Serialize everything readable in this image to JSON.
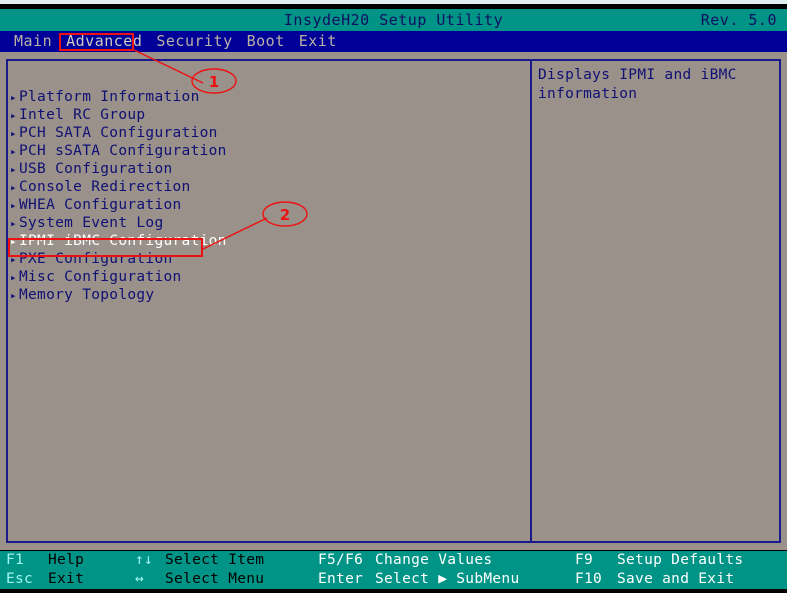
{
  "window": {
    "title": "InsydeH20 Setup Utility",
    "revision": "Rev. 5.0"
  },
  "menubar": {
    "tabs": [
      {
        "label": "Main",
        "active": false
      },
      {
        "label": "Advanced",
        "active": true
      },
      {
        "label": "Security",
        "active": false
      },
      {
        "label": "Boot",
        "active": false
      },
      {
        "label": "Exit",
        "active": false
      }
    ]
  },
  "main": {
    "items": [
      {
        "caret": "▸",
        "label": "Platform Information",
        "selected": false
      },
      {
        "caret": "▸",
        "label": "Intel RC Group",
        "selected": false
      },
      {
        "caret": "▸",
        "label": "PCH SATA Configuration",
        "selected": false
      },
      {
        "caret": "▸",
        "label": "PCH sSATA Configuration",
        "selected": false
      },
      {
        "caret": "▸",
        "label": "USB Configuration",
        "selected": false
      },
      {
        "caret": "▸",
        "label": "Console Redirection",
        "selected": false
      },
      {
        "caret": "▸",
        "label": "WHEA Configuration",
        "selected": false
      },
      {
        "caret": "▸",
        "label": "System Event Log",
        "selected": false
      },
      {
        "caret": "▸",
        "label": "IPMI iBMC Configuration",
        "selected": true
      },
      {
        "caret": "▸",
        "label": "PXE Configuration",
        "selected": false
      },
      {
        "caret": "▸",
        "label": "Misc Configuration",
        "selected": false
      },
      {
        "caret": "▸",
        "label": "Memory Topology",
        "selected": false
      }
    ]
  },
  "help": {
    "line1": "Displays IPMI and iBMC",
    "line2": "information"
  },
  "footer": {
    "col1": [
      {
        "key": "F1",
        "label": "Help"
      },
      {
        "key": "Esc",
        "label": "Exit"
      }
    ],
    "col2": [
      {
        "key": "↑↓",
        "label": "Select Item"
      },
      {
        "key": "↔",
        "label": "Select Menu"
      }
    ],
    "col3": [
      {
        "key": "F5/F6",
        "label": "Change Values"
      },
      {
        "key": "Enter",
        "label": "Select ▶ SubMenu"
      }
    ],
    "col4": [
      {
        "key": "F9",
        "label": "Setup Defaults"
      },
      {
        "key": "F10",
        "label": "Save and Exit"
      }
    ]
  },
  "annotations": [
    {
      "number": "1",
      "target": "advanced-tab"
    },
    {
      "number": "2",
      "target": "ipmi-ibmc-configuration-item"
    }
  ],
  "colors": {
    "titlebar_bg": "#009486",
    "menubar_bg": "#000099",
    "panel_bg": "#99918a",
    "border": "#1a1a8c",
    "text_primary": "#101075",
    "text_selected": "#ffffff",
    "footer_bg": "#009486",
    "annotation": "#ee1111"
  }
}
